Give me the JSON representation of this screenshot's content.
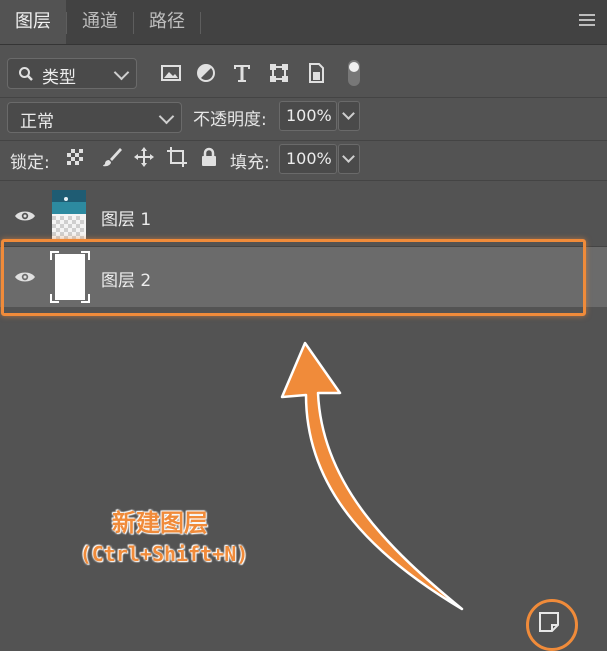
{
  "tabs": [
    {
      "label": "图层",
      "active": true
    },
    {
      "label": "通道",
      "active": false
    },
    {
      "label": "路径",
      "active": false
    }
  ],
  "filter": {
    "kind_label": "类型"
  },
  "blend_mode": {
    "value": "正常"
  },
  "opacity": {
    "label": "不透明度:",
    "value": "100%"
  },
  "lock": {
    "label": "锁定:"
  },
  "fill": {
    "label": "填充:",
    "value": "100%"
  },
  "layers": [
    {
      "name": "图层 1",
      "visible": true,
      "selected": false
    },
    {
      "name": "图层 2",
      "visible": true,
      "selected": true
    }
  ],
  "annotation": {
    "title": "新建图层",
    "shortcut": "(Ctrl+Shift+N)"
  },
  "colors": {
    "panel_bg": "#535353",
    "tab_bar_bg": "#424242",
    "selected_row": "#6b6b6b",
    "highlight": "#f08b3a"
  },
  "icons": {
    "menu": "hamburger-icon",
    "search": "search-icon",
    "image_filter": "image-icon",
    "adjustment_filter": "half-circle-icon",
    "type_filter": "text-icon",
    "shape_filter": "transform-icon",
    "smart_object_filter": "smart-object-icon",
    "filter_toggle": "toggle-icon",
    "lock_transparent": "checkerboard-icon",
    "lock_pixels": "brush-icon",
    "lock_position": "move-icon",
    "lock_artboard": "crop-icon",
    "lock_all": "lock-icon",
    "visibility": "eye-icon",
    "new_layer": "new-layer-icon"
  }
}
